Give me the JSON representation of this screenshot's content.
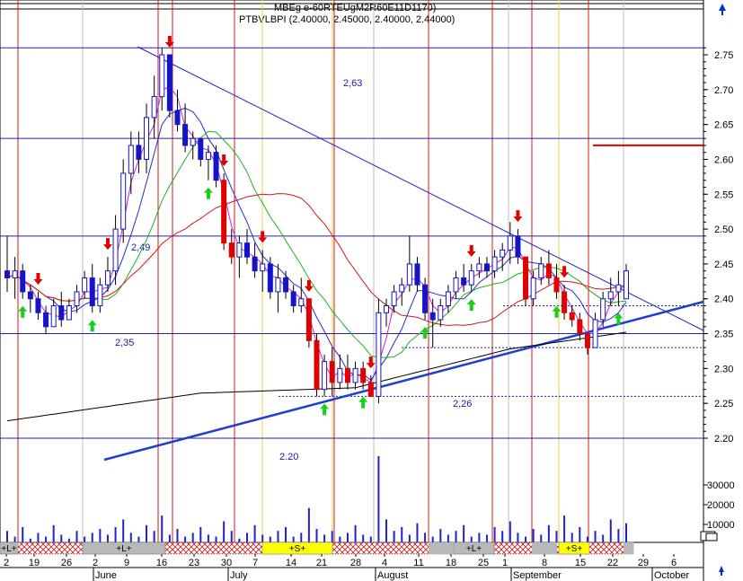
{
  "header": {
    "title_overlap": "MBEg e-60RTEUgM2R60E11D1170)",
    "symbol_line": "PTBVLBPI (2.40000, 2.45000, 2.40000, 2.44000)"
  },
  "chart_data": {
    "type": "candlestick",
    "price_axis": {
      "ylim": [
        2.165,
        2.795
      ],
      "ticks": [
        "2.75",
        "2.70",
        "2.65",
        "2.60",
        "2.55",
        "2.50",
        "2.45",
        "2.40",
        "2.35",
        "2.30",
        "2.25",
        "2.20"
      ]
    },
    "volume_axis": {
      "ticks": [
        "30000",
        "20000",
        "10000"
      ]
    },
    "x_axis": {
      "day_labels": [
        "2",
        "19",
        "26",
        "2",
        "9",
        "16",
        "23",
        "30",
        "7",
        "14",
        "21",
        "28",
        "4",
        "11",
        "18",
        "25",
        "1",
        "8",
        "15",
        "22",
        "29",
        "6"
      ],
      "month_labels": [
        "June",
        "July",
        "August",
        "September",
        "October"
      ]
    },
    "levels": [
      {
        "value": 2.76,
        "label": ""
      },
      {
        "value": 2.63,
        "label": "2,63"
      },
      {
        "value": 2.49,
        "label": "2,49"
      },
      {
        "value": 2.35,
        "label": "2,35"
      },
      {
        "value": 2.2,
        "label": "2.20"
      }
    ],
    "dotted_levels": [
      {
        "value": 2.26,
        "label": "2,26"
      },
      {
        "value": 2.33,
        "label": ""
      },
      {
        "value": 2.39,
        "label": ""
      }
    ],
    "red_marker_level": 2.62,
    "signal_strip": [
      "+L+",
      "+L+",
      "+S+",
      "+L+",
      "+S+"
    ],
    "ohlc": [
      [
        2.44,
        2.49,
        2.41,
        2.43
      ],
      [
        2.43,
        2.46,
        2.4,
        2.44
      ],
      [
        2.44,
        2.45,
        2.4,
        2.41
      ],
      [
        2.41,
        2.42,
        2.38,
        2.4
      ],
      [
        2.4,
        2.41,
        2.37,
        2.38
      ],
      [
        2.38,
        2.39,
        2.35,
        2.36
      ],
      [
        2.36,
        2.4,
        2.36,
        2.39
      ],
      [
        2.39,
        2.41,
        2.36,
        2.37
      ],
      [
        2.37,
        2.4,
        2.37,
        2.39
      ],
      [
        2.39,
        2.42,
        2.38,
        2.41
      ],
      [
        2.41,
        2.44,
        2.4,
        2.43
      ],
      [
        2.43,
        2.45,
        2.38,
        2.39
      ],
      [
        2.39,
        2.43,
        2.38,
        2.42
      ],
      [
        2.42,
        2.46,
        2.41,
        2.44
      ],
      [
        2.44,
        2.52,
        2.42,
        2.5
      ],
      [
        2.5,
        2.6,
        2.48,
        2.58
      ],
      [
        2.58,
        2.64,
        2.55,
        2.62
      ],
      [
        2.62,
        2.64,
        2.58,
        2.6
      ],
      [
        2.6,
        2.68,
        2.58,
        2.66
      ],
      [
        2.66,
        2.72,
        2.63,
        2.69
      ],
      [
        2.69,
        2.76,
        2.67,
        2.75
      ],
      [
        2.75,
        2.75,
        2.66,
        2.67
      ],
      [
        2.67,
        2.7,
        2.64,
        2.65
      ],
      [
        2.65,
        2.68,
        2.61,
        2.62
      ],
      [
        2.62,
        2.64,
        2.6,
        2.63
      ],
      [
        2.63,
        2.63,
        2.59,
        2.6
      ],
      [
        2.6,
        2.62,
        2.57,
        2.61
      ],
      [
        2.61,
        2.62,
        2.56,
        2.57
      ],
      [
        2.57,
        2.58,
        2.47,
        2.48
      ],
      [
        2.48,
        2.5,
        2.45,
        2.46
      ],
      [
        2.46,
        2.49,
        2.43,
        2.48
      ],
      [
        2.48,
        2.5,
        2.45,
        2.46
      ],
      [
        2.46,
        2.48,
        2.43,
        2.44
      ],
      [
        2.44,
        2.47,
        2.41,
        2.45
      ],
      [
        2.45,
        2.46,
        2.4,
        2.41
      ],
      [
        2.41,
        2.45,
        2.38,
        2.43
      ],
      [
        2.43,
        2.44,
        2.4,
        2.41
      ],
      [
        2.41,
        2.42,
        2.38,
        2.39
      ],
      [
        2.39,
        2.43,
        2.38,
        2.4
      ],
      [
        2.4,
        2.4,
        2.33,
        2.34
      ],
      [
        2.34,
        2.35,
        2.26,
        2.27
      ],
      [
        2.27,
        2.32,
        2.26,
        2.31
      ],
      [
        2.31,
        2.33,
        2.26,
        2.28
      ],
      [
        2.28,
        2.32,
        2.27,
        2.3
      ],
      [
        2.3,
        2.32,
        2.27,
        2.28
      ],
      [
        2.28,
        2.31,
        2.27,
        2.3
      ],
      [
        2.3,
        2.31,
        2.27,
        2.28
      ],
      [
        2.28,
        2.29,
        2.26,
        2.26
      ],
      [
        2.26,
        2.4,
        2.25,
        2.38
      ],
      [
        2.38,
        2.4,
        2.36,
        2.39
      ],
      [
        2.39,
        2.42,
        2.38,
        2.41
      ],
      [
        2.41,
        2.43,
        2.39,
        2.42
      ],
      [
        2.42,
        2.49,
        2.41,
        2.45
      ],
      [
        2.45,
        2.46,
        2.41,
        2.42
      ],
      [
        2.42,
        2.43,
        2.37,
        2.38
      ],
      [
        2.38,
        2.4,
        2.33,
        2.37
      ],
      [
        2.37,
        2.4,
        2.36,
        2.39
      ],
      [
        2.39,
        2.42,
        2.38,
        2.41
      ],
      [
        2.41,
        2.44,
        2.4,
        2.43
      ],
      [
        2.43,
        2.45,
        2.41,
        2.42
      ],
      [
        2.42,
        2.45,
        2.41,
        2.44
      ],
      [
        2.44,
        2.46,
        2.43,
        2.45
      ],
      [
        2.45,
        2.46,
        2.43,
        2.44
      ],
      [
        2.44,
        2.47,
        2.43,
        2.46
      ],
      [
        2.46,
        2.48,
        2.44,
        2.47
      ],
      [
        2.47,
        2.51,
        2.45,
        2.49
      ],
      [
        2.49,
        2.5,
        2.45,
        2.46
      ],
      [
        2.46,
        2.46,
        2.39,
        2.4
      ],
      [
        2.4,
        2.44,
        2.39,
        2.43
      ],
      [
        2.43,
        2.46,
        2.42,
        2.45
      ],
      [
        2.45,
        2.47,
        2.42,
        2.43
      ],
      [
        2.43,
        2.45,
        2.4,
        2.41
      ],
      [
        2.41,
        2.42,
        2.37,
        2.38
      ],
      [
        2.38,
        2.39,
        2.36,
        2.37
      ],
      [
        2.37,
        2.38,
        2.34,
        2.35
      ],
      [
        2.35,
        2.35,
        2.32,
        2.33
      ],
      [
        2.33,
        2.38,
        2.33,
        2.37
      ],
      [
        2.37,
        2.41,
        2.36,
        2.4
      ],
      [
        2.4,
        2.43,
        2.39,
        2.41
      ],
      [
        2.41,
        2.44,
        2.39,
        2.42
      ],
      [
        2.4,
        2.45,
        2.4,
        2.44
      ]
    ],
    "volume": [
      6,
      3,
      8,
      2,
      5,
      3,
      9,
      4,
      2,
      6,
      3,
      5,
      7,
      4,
      8,
      12,
      5,
      3,
      9,
      6,
      14,
      4,
      7,
      3,
      5,
      8,
      4,
      3,
      11,
      6,
      2,
      5,
      9,
      4,
      3,
      6,
      8,
      3,
      5,
      18,
      7,
      4,
      6,
      3,
      5,
      9,
      4,
      3,
      45,
      12,
      6,
      8,
      4,
      10,
      5,
      3,
      7,
      4,
      6,
      9,
      3,
      5,
      4,
      8,
      6,
      11,
      5,
      3,
      7,
      4,
      9,
      6,
      14,
      5,
      8,
      3,
      6,
      4,
      12,
      7,
      10
    ],
    "buy_signals": [
      2,
      11,
      26,
      41,
      46,
      54,
      60,
      71,
      79
    ],
    "sell_signals": [
      4,
      13,
      21,
      28,
      33,
      39,
      47,
      60,
      66,
      72
    ],
    "highlighted_sessions": [
      6,
      21,
      25,
      47,
      67,
      72,
      77
    ]
  }
}
